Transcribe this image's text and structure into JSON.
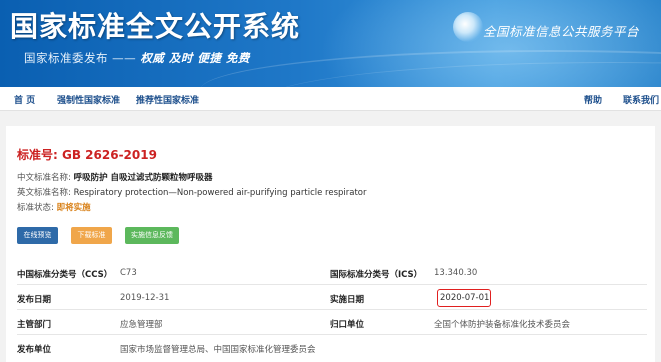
{
  "header": {
    "site_title": "国家标准全文公开系统",
    "slogan_publisher": "国家标准委发布",
    "slogan_dash": "——",
    "slogan_words": "权威 及时 便捷 免费",
    "platform_name": "全国标准信息公共服务平台"
  },
  "nav": {
    "home": "首 页",
    "mandatory": "强制性国家标准",
    "recommended": "推荐性国家标准",
    "help": "帮助",
    "contact": "联系我们"
  },
  "standard": {
    "number_label": "标准号:",
    "number": "GB 2626-2019",
    "cn_name_label": "中文标准名称:",
    "cn_name": "呼吸防护 自吸过滤式防颗粒物呼吸器",
    "en_name_label": "英文标准名称:",
    "en_name": "Respiratory protection—Non-powered air-purifying particle respirator",
    "status_label": "标准状态:",
    "status": "即将实施"
  },
  "buttons": {
    "preview": "在线预览",
    "download": "下载标准",
    "feedback": "实施信息反馈"
  },
  "details": {
    "ccs_label": "中国标准分类号（CCS）",
    "ccs_value": "C73",
    "ics_label": "国际标准分类号（ICS）",
    "ics_value": "13.340.30",
    "publish_label": "发布日期",
    "publish_value": "2019-12-31",
    "implement_label": "实施日期",
    "implement_value": "2020-07-01",
    "dept_label": "主管部门",
    "dept_value": "应急管理部",
    "owner_label": "归口单位",
    "owner_value": "全国个体防护装备标准化技术委员会",
    "issuer_label": "发布单位",
    "issuer_value": "国家市场监督管理总局、中国国家标准化管理委员会"
  },
  "colors": {
    "banner_blue": "#1f78c8",
    "nav_link": "#1d4f8c",
    "std_number_red": "#cc2222",
    "status_orange": "#d9821a",
    "btn_preview": "#2e6aa8",
    "btn_download": "#f0a64a",
    "btn_feedback": "#5cb85c",
    "highlight_red": "#e02020"
  }
}
